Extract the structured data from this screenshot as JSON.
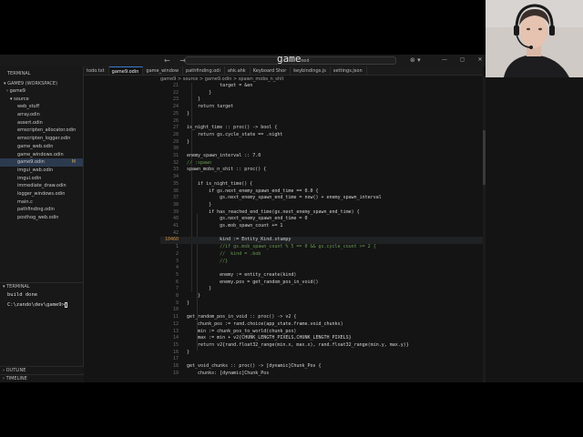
{
  "titlebar": {
    "nav_arrows": "← →",
    "command_center": "game",
    "command_center_suffix": "mod",
    "copilot": "⊛ ▾",
    "window_controls": "— ▢ ✕"
  },
  "sidebar": {
    "header": "TERMINAL",
    "workspace": "GAME9 (WORKSPACE)",
    "root": "game9",
    "source_folder": "source",
    "files": [
      {
        "label": "web_stuff",
        "badge": "",
        "active": false
      },
      {
        "label": "array.odin",
        "badge": "",
        "active": false
      },
      {
        "label": "assert.odin",
        "badge": "",
        "active": false
      },
      {
        "label": "emscripten_allocator.odin",
        "badge": "",
        "active": false
      },
      {
        "label": "emscripten_logger.odin",
        "badge": "",
        "active": false
      },
      {
        "label": "game_web.odin",
        "badge": "",
        "active": false
      },
      {
        "label": "game_windows.odin",
        "badge": "",
        "active": false
      },
      {
        "label": "game9.odin",
        "badge": "M",
        "active": true
      },
      {
        "label": "imgui_web.odin",
        "badge": "",
        "active": false
      },
      {
        "label": "imgui.odin",
        "badge": "",
        "active": false
      },
      {
        "label": "immediate_draw.odin",
        "badge": "",
        "active": false
      },
      {
        "label": "logger_windows.odin",
        "badge": "",
        "active": false
      },
      {
        "label": "main.c",
        "badge": "",
        "active": false
      },
      {
        "label": "pathfinding.odin",
        "badge": "",
        "active": false
      },
      {
        "label": "posthog_web.odin",
        "badge": "",
        "active": false
      }
    ],
    "terminal_section": "TERMINAL",
    "terminal_lines": [
      "build done",
      "C:\\zando\\dev\\game9>"
    ],
    "outline": "OUTLINE",
    "timeline": "TIMELINE"
  },
  "tabs": [
    {
      "label": "todo.txt",
      "active": false
    },
    {
      "label": "game9.odin",
      "active": true
    },
    {
      "label": "game_window",
      "active": false
    },
    {
      "label": "pathfinding.odi",
      "active": false
    },
    {
      "label": "ahk.ahk",
      "active": false
    },
    {
      "label": "Keyboard Shor",
      "active": false
    },
    {
      "label": "keybindings.js",
      "active": false
    },
    {
      "label": "settings.json",
      "active": false
    }
  ],
  "breadcrumb": "game9 > source > game9.odin > spawn_mobs_n_shit",
  "code_lines": [
    {
      "n": "21",
      "text": "            target = &en",
      "hl": false
    },
    {
      "n": "22",
      "text": "        }",
      "hl": false
    },
    {
      "n": "23",
      "text": "    }",
      "hl": false
    },
    {
      "n": "24",
      "text": "    return target",
      "hl": false
    },
    {
      "n": "25",
      "text": "}",
      "hl": false
    },
    {
      "n": "26",
      "text": "",
      "hl": false
    },
    {
      "n": "27",
      "text": "is_night_time :: proc() -> bool {",
      "hl": false
    },
    {
      "n": "28",
      "text": "    return gs.cycle_state == .night",
      "hl": false
    },
    {
      "n": "29",
      "text": "}",
      "hl": false
    },
    {
      "n": "30",
      "text": "",
      "hl": false
    },
    {
      "n": "31",
      "text": "enemy_spawn_interval :: 7.0",
      "hl": false
    },
    {
      "n": "32",
      "text": "// :spawn",
      "hl": false
    },
    {
      "n": "33",
      "text": "spawn_mobs_n_shit :: proc() {",
      "hl": false
    },
    {
      "n": "34",
      "text": "",
      "hl": false
    },
    {
      "n": "35",
      "text": "    if is_night_time() {",
      "hl": false
    },
    {
      "n": "36",
      "text": "        if gs.next_enemy_spawn_end_time == 0.0 {",
      "hl": false
    },
    {
      "n": "37",
      "text": "            gs.next_enemy_spawn_end_time = now() + enemy_spawn_interval",
      "hl": false
    },
    {
      "n": "38",
      "text": "        }",
      "hl": false
    },
    {
      "n": "39",
      "text": "        if has_reached_end_time(gs.next_enemy_spawn_end_time) {",
      "hl": false
    },
    {
      "n": "40",
      "text": "            gs.next_enemy_spawn_end_time = 0",
      "hl": false
    },
    {
      "n": "41",
      "text": "            gs.mob_spawn_count += 1",
      "hl": false
    },
    {
      "n": "42",
      "text": "",
      "hl": false
    },
    {
      "n": "10460",
      "text": "            kind := Entity_Kind.stumpy",
      "hl": true
    },
    {
      "n": "1",
      "text": "            //if gs.mob_spawn_count % 5 == 0 && gs.cycle_count >= 2 {",
      "hl": false
    },
    {
      "n": "2",
      "text": "            //  kind = .bob",
      "hl": false
    },
    {
      "n": "3",
      "text": "            //}",
      "hl": false
    },
    {
      "n": "4",
      "text": "",
      "hl": false
    },
    {
      "n": "5",
      "text": "            enemy := entity_create(kind)",
      "hl": false
    },
    {
      "n": "6",
      "text": "            enemy.pos = get_random_pos_in_void()",
      "hl": false
    },
    {
      "n": "7",
      "text": "        }",
      "hl": false
    },
    {
      "n": "8",
      "text": "    }",
      "hl": false
    },
    {
      "n": "9",
      "text": "}",
      "hl": false
    },
    {
      "n": "10",
      "text": "",
      "hl": false
    },
    {
      "n": "11",
      "text": "get_random_pos_in_void :: proc() -> v2 {",
      "hl": false
    },
    {
      "n": "12",
      "text": "    chunk_pos := rand.choice(app_state.frame.void_chunks)",
      "hl": false
    },
    {
      "n": "13",
      "text": "    min := chunk_pos_to_world(chunk_pos)",
      "hl": false
    },
    {
      "n": "14",
      "text": "    max := min + v2{CHUNK_LENGTH_PIXELS,CHUNK_LENGTH_PIXELS}",
      "hl": false
    },
    {
      "n": "15",
      "text": "    return v2{rand.float32_range(min.x, max.x), rand.float32_range(min.y, max.y)}",
      "hl": false
    },
    {
      "n": "16",
      "text": "}",
      "hl": false
    },
    {
      "n": "17",
      "text": "",
      "hl": false
    },
    {
      "n": "18",
      "text": "get_void_chunks :: proc() -> [dynamic]Chunk_Pos {",
      "hl": false
    },
    {
      "n": "19",
      "text": "    chunks: [dynamic]Chunk_Pos",
      "hl": false
    }
  ],
  "colors": {
    "keyword": "#c586c0",
    "function": "#dcdcaa",
    "type": "#4ec9b0",
    "number": "#b5cea8",
    "comment": "#6a9955",
    "accent": "#3a7bd5"
  },
  "webcam": {
    "description_icon": "webcam-person-icon"
  }
}
